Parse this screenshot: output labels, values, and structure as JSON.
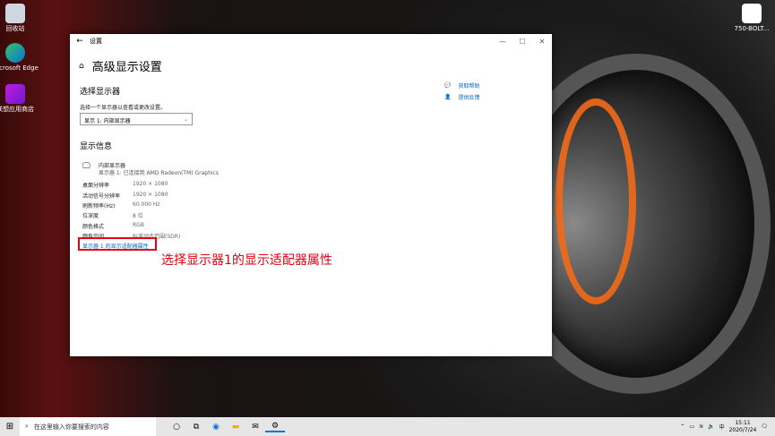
{
  "desktop": {
    "icons": [
      {
        "label": "回收站"
      },
      {
        "label": "Microsoft Edge"
      },
      {
        "label": "联想应用商店"
      }
    ],
    "top_right_icon": "750-BOLT..."
  },
  "window": {
    "title": "设置",
    "back": "←",
    "minimize": "—",
    "maximize": "☐",
    "close": "✕",
    "page_title": "高级显示设置",
    "select_display_heading": "选择显示器",
    "select_display_hint": "选择一个显示器以查看或更改设置。",
    "display_dropdown_value": "显示 1: 内部显示器",
    "display_info_heading": "显示信息",
    "monitor_name": "内部显示器",
    "monitor_sub": "显示器 1: 已连接到 AMD Radeon(TM) Graphics",
    "info_rows": [
      {
        "key": "桌面分辨率",
        "value": "1920 × 1080"
      },
      {
        "key": "活动信号分辨率",
        "value": "1920 × 1080"
      },
      {
        "key": "刷新频率(Hz)",
        "value": "60.000 Hz"
      },
      {
        "key": "位深度",
        "value": "8 位"
      },
      {
        "key": "颜色格式",
        "value": "RGB"
      },
      {
        "key": "颜色空间",
        "value": "标准动态范围(SDR)"
      }
    ],
    "adapter_link": "显示器 1 的显示适配器属性",
    "help_link": "获取帮助",
    "feedback_link": "提供反馈"
  },
  "annotation": "选择显示器1的显示适配器属性",
  "taskbar": {
    "search_placeholder": "在这里输入你要搜索的内容",
    "time": "15:11",
    "date": "2020/7/24"
  }
}
